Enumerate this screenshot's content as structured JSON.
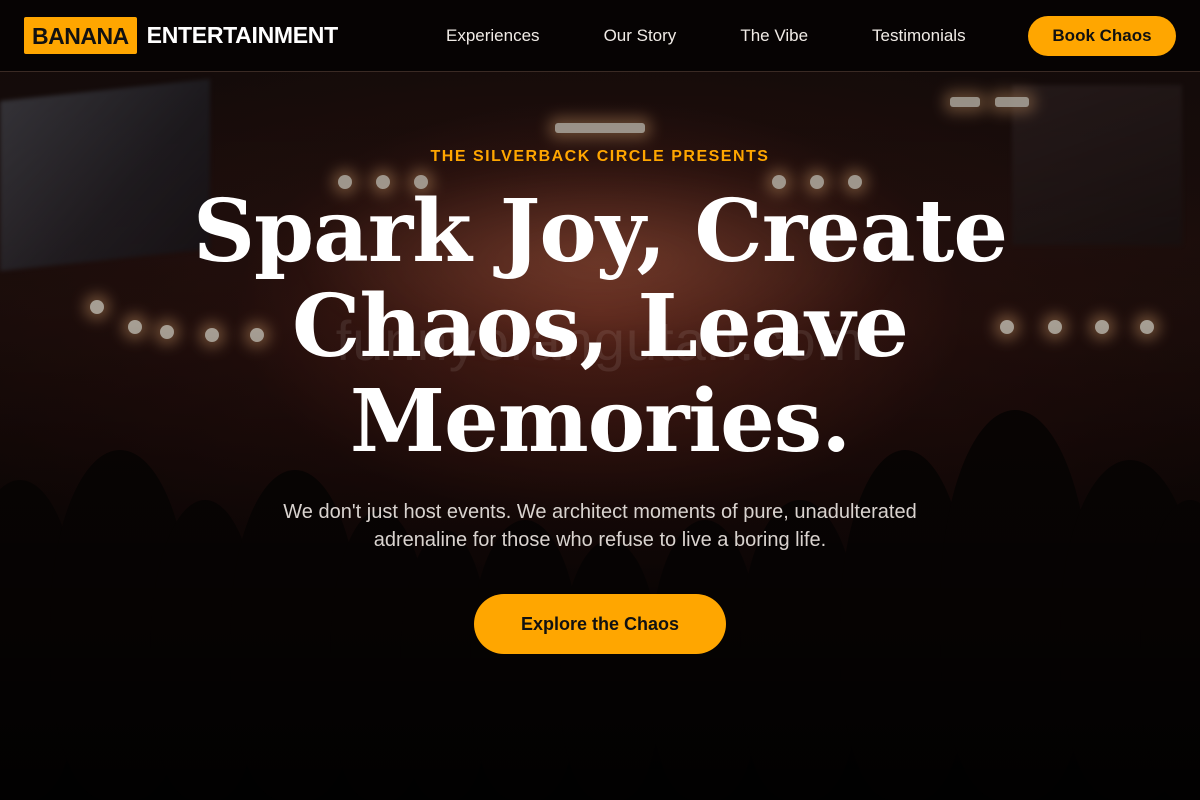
{
  "brand": {
    "logo_box": "BANANA",
    "logo_text": "ENTERTAINMENT",
    "accent": "#ffa600"
  },
  "nav": {
    "items": [
      {
        "label": "Experiences"
      },
      {
        "label": "Our Story"
      },
      {
        "label": "The Vibe"
      },
      {
        "label": "Testimonials"
      }
    ],
    "cta": "Book Chaos"
  },
  "hero": {
    "eyebrow": "THE SILVERBACK CIRCLE PRESENTS",
    "headline": "Spark Joy, Create Chaos, Leave Memories.",
    "subheadline": "We don't just host events. We architect moments of pure, unadulterated adrenaline for those who refuse to live a boring life.",
    "cta": "Explore the Chaos",
    "watermark": "funnyorangutan.com",
    "background": "concert-crowd-photo"
  }
}
